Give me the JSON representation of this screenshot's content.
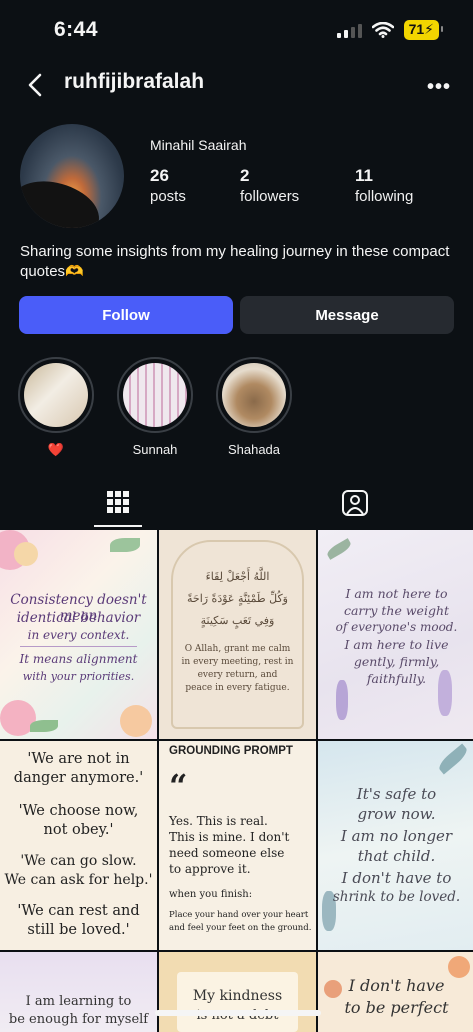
{
  "status_bar": {
    "time": "6:44",
    "battery": "71"
  },
  "header": {
    "username": "ruhfijibrafalah",
    "more": "•••"
  },
  "profile": {
    "display_name": "Minahil Saairah",
    "stats": [
      {
        "value": "26",
        "label": "posts"
      },
      {
        "value": "2",
        "label": "followers"
      },
      {
        "value": "11",
        "label": "following"
      }
    ],
    "bio": "Sharing some insights from my healing journey in these compact quotes🫶"
  },
  "buttons": {
    "follow": "Follow",
    "message": "Message"
  },
  "highlights": [
    {
      "label": "❤️"
    },
    {
      "label": "Sunnah"
    },
    {
      "label": "Shahada"
    }
  ],
  "grid": {
    "t1": {
      "line1": "Consistency doesn't mean",
      "line2": "identical behavior",
      "line3": "in every context.",
      "line4": "It means alignment",
      "line5": "with your priorities."
    },
    "t2": {
      "arabic1": "اللَّهُ أَجْعَلْ لِقَاءَ",
      "arabic2": "وَكُلِّ طَمْئِنَّةٍ عَوْدَةً رَاحَةً",
      "arabic3": "وَفِي تَعَبٍ سَكِينَةٍ",
      "line1": "O Allah, grant me calm",
      "line2": "in every meeting, rest in",
      "line3": "every return, and",
      "line4": "peace in every fatigue."
    },
    "t3": {
      "line1": "I am not here to",
      "line2": "carry the weight",
      "line3": "of everyone's mood.",
      "line4": "I am here to live",
      "line5": "gently, firmly,",
      "line6": "faithfully."
    },
    "t4": {
      "line1": "'We are not in",
      "line2": "danger anymore.'",
      "line3": "'We choose now,",
      "line4": "not obey.'",
      "line5": "'We can go slow.",
      "line6": "We can ask for help.'",
      "line7": "'We can rest and",
      "line8": "still be loved.'"
    },
    "t5": {
      "title": "GROUNDING PROMPT",
      "quote_mark": "“",
      "line1": "Yes. This is real.",
      "line2": "This is mine. I don't",
      "line3": "need someone else",
      "line4": "to approve it.",
      "line5": "when you finish:",
      "line6": "Place your hand over your heart",
      "line7": "and feel your feet on the ground."
    },
    "t6": {
      "line1": "It's safe to",
      "line2": "grow now.",
      "line3": "I am no longer",
      "line4": "that child.",
      "line5": "I don't have to",
      "line6": "shrink to be loved."
    },
    "t7": {
      "line1": "I am learning to",
      "line2": "be enough for myself"
    },
    "t8": {
      "line1": "My kindness",
      "line2": "is not a debt"
    },
    "t9": {
      "line1": "I don't have",
      "line2": "to be perfect"
    }
  },
  "colors": {
    "background": "#0c1014",
    "follow": "#4a5df9",
    "message": "#262a30",
    "battery": "#f2d500"
  }
}
